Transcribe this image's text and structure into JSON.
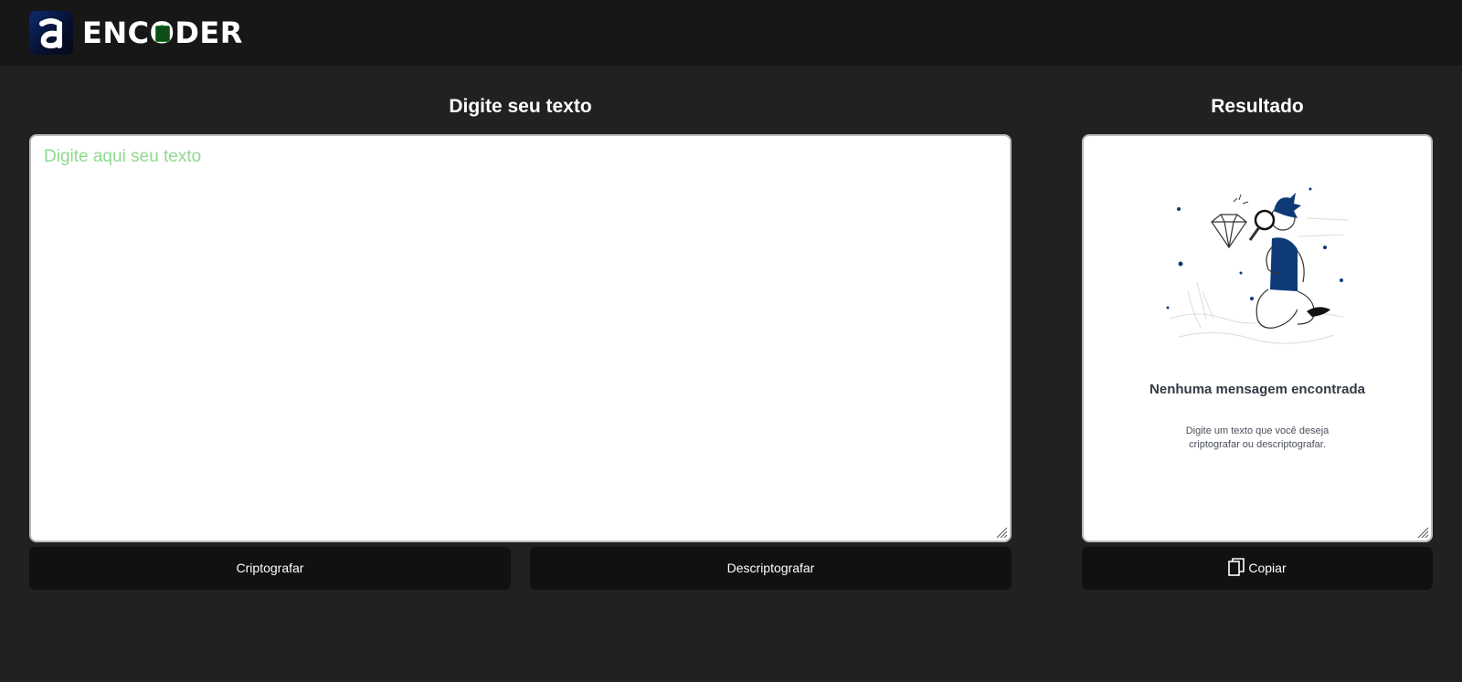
{
  "header": {
    "logo_text": "ENCODER",
    "logo_badge_letter": "a"
  },
  "input_section": {
    "title": "Digite seu texto",
    "placeholder": "Digite aqui seu texto"
  },
  "result_section": {
    "title": "Resultado",
    "empty_title": "Nenhuma mensagem encontrada",
    "empty_description": "Digite um texto que você deseja criptografar ou descriptografar."
  },
  "buttons": {
    "encrypt_label": "Criptografar",
    "decrypt_label": "Descriptografar",
    "copy_label": "Copiar"
  },
  "colors": {
    "background": "#212121",
    "header": "#171717",
    "button": "#111111",
    "placeholder": "#8fd98f",
    "illustration_accent": "#0e3a78"
  }
}
